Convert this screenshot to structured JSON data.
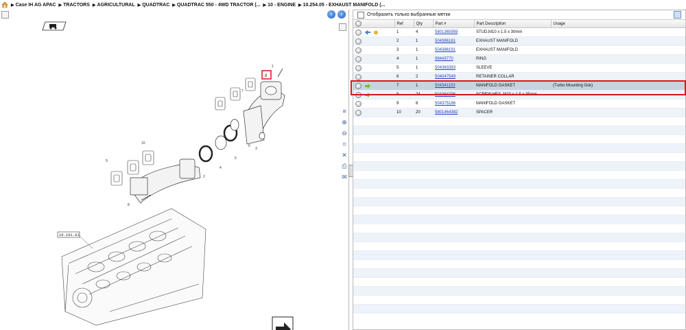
{
  "breadcrumbs": [
    "Case IH AG APAC",
    "TRACTORS",
    "AGRICULTURAL",
    "QUADTRAC",
    "QUADTRAC 550 - 4WD TRACTOR (...",
    "10 - ENGINE",
    "10.254.05 - EXHAUST MANIFOLD (..."
  ],
  "diagram": {
    "callout_reference": "10.101.01",
    "highlighted_ref": "8",
    "ref_labels": [
      "1",
      "2",
      "3",
      "4",
      "5",
      "6",
      "7",
      "8",
      "9",
      "10"
    ]
  },
  "filter": {
    "label": "Отобразить только выбранные метки"
  },
  "table": {
    "columns": [
      "Ref",
      "Qty",
      "Part #",
      "Part Description",
      "Usage"
    ],
    "rows": [
      {
        "ref": "1",
        "qty": "4",
        "part": "5801365959",
        "desc": "STUD,M10 x 1.5 x 30mm",
        "usage": ""
      },
      {
        "ref": "2",
        "qty": "1",
        "part": "504386161",
        "desc": "EXHAUST MANIFOLD",
        "usage": ""
      },
      {
        "ref": "3",
        "qty": "1",
        "part": "504386191",
        "desc": "EXHAUST MANIFOLD",
        "usage": ""
      },
      {
        "ref": "4",
        "qty": "1",
        "part": "99443770",
        "desc": "RING",
        "usage": ""
      },
      {
        "ref": "5",
        "qty": "1",
        "part": "504383383",
        "desc": "SLEEVE",
        "usage": ""
      },
      {
        "ref": "6",
        "qty": "2",
        "part": "504047549",
        "desc": "RETAINER COLLAR",
        "usage": ""
      },
      {
        "ref": "7",
        "qty": "1",
        "part": "504341103",
        "desc": "MANIFOLD GASKET",
        "usage": "(Turbo Mounting Gsk)"
      },
      {
        "ref": "8",
        "qty": "24",
        "part": "504364296",
        "desc": "SCREW,HEX. M10 x 1.5 x 35mm",
        "usage": ""
      },
      {
        "ref": "9",
        "qty": "6",
        "part": "504375186",
        "desc": "MANIFOLD GASKET",
        "usage": ""
      },
      {
        "ref": "10",
        "qty": "20",
        "part": "5801464382",
        "desc": "SPACER",
        "usage": ""
      }
    ]
  },
  "colors": {
    "highlight": "#e0101a",
    "link": "#1f3fbf",
    "selected_row": "#c9d3e0"
  }
}
